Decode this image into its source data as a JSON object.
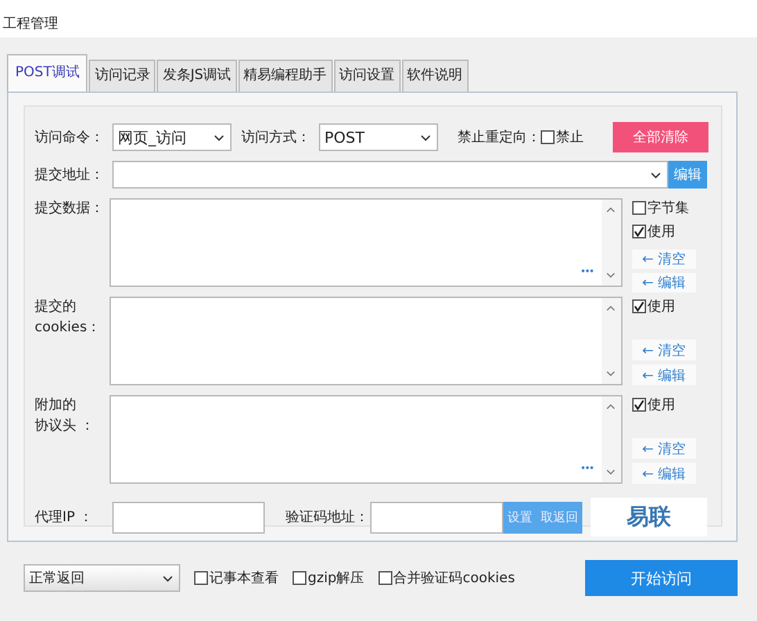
{
  "menu": [
    "工程管理"
  ],
  "tabs": [
    {
      "label": "POST调试",
      "selected": true
    },
    {
      "label": "访问记录",
      "selected": false
    },
    {
      "label": "发条JS调试",
      "selected": false
    },
    {
      "label": "精易编程助手",
      "selected": false
    },
    {
      "label": "访问设置",
      "selected": false
    },
    {
      "label": "软件说明",
      "selected": false
    }
  ],
  "command": {
    "label": "访问命令：",
    "value": "网页_访问"
  },
  "method": {
    "label": "访问方式：",
    "value": "POST"
  },
  "no_redirect": {
    "label": "禁止重定向：",
    "option": "禁止",
    "checked": false
  },
  "clear_all": "全部清除",
  "address": {
    "label": "提交地址：",
    "edit": "编辑"
  },
  "sections": [
    {
      "label_lines": [
        "提交数据："
      ],
      "more": "•••",
      "options": [
        {
          "label": "字节集",
          "checked": false
        },
        {
          "label": "使用",
          "checked": true
        }
      ],
      "buttons": [
        "← 清空",
        "← 编辑"
      ]
    },
    {
      "label_lines": [
        "提交的",
        "cookies："
      ],
      "options": [
        {
          "label": "使用",
          "checked": true
        }
      ],
      "buttons": [
        "← 清空",
        "← 编辑"
      ]
    },
    {
      "label_lines": [
        "附加的",
        "协议头 ："
      ],
      "more": "•••",
      "options": [
        {
          "label": "使用",
          "checked": true
        }
      ],
      "buttons": [
        "← 清空",
        "← 编辑"
      ]
    }
  ],
  "proxy": {
    "label": "代理IP ："
  },
  "captcha": {
    "label": "验证码地址：",
    "buttons": [
      "设置",
      "取返回"
    ]
  },
  "logo": "易联",
  "bottom": {
    "mode": "正常返回",
    "options": [
      {
        "label": "记事本查看",
        "checked": false
      },
      {
        "label": "gzip解压",
        "checked": false
      },
      {
        "label": "合并验证码cookies",
        "checked": false
      }
    ],
    "start": "开始访问"
  }
}
